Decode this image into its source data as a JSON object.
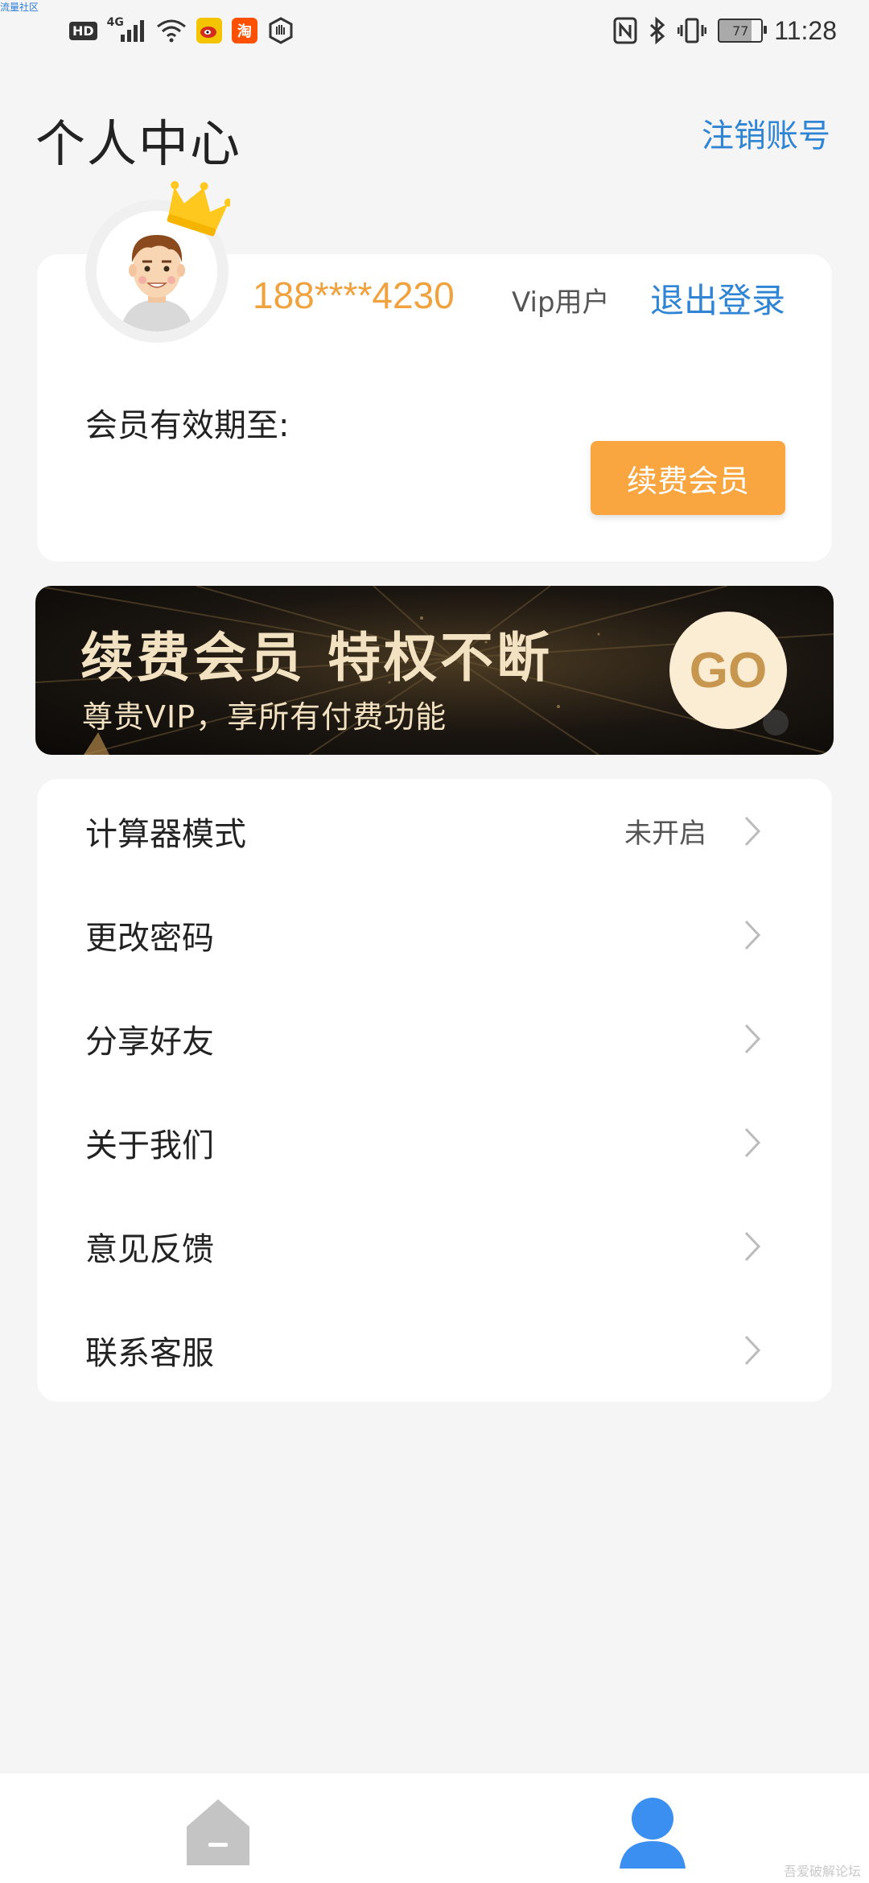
{
  "watermark_top": "流量社区",
  "status_bar": {
    "hd": "HD",
    "network": "4G",
    "weibo_icon": "weibo-icon",
    "taobao_label": "淘",
    "battery": "77",
    "time": "11:28"
  },
  "header": {
    "title": "个人中心",
    "cancel_account": "注销账号"
  },
  "profile": {
    "phone": "188****4230",
    "user_type": "Vip用户",
    "logout": "退出登录",
    "expiry_label": "会员有效期至:",
    "renew_button": "续费会员"
  },
  "banner": {
    "title": "续费会员 特权不断",
    "subtitle": "尊贵VIP，享所有付费功能",
    "go": "GO"
  },
  "menu": {
    "items": [
      {
        "label": "计算器模式",
        "value": "未开启"
      },
      {
        "label": "更改密码",
        "value": ""
      },
      {
        "label": "分享好友",
        "value": ""
      },
      {
        "label": "关于我们",
        "value": ""
      },
      {
        "label": "意见反馈",
        "value": ""
      },
      {
        "label": "联系客服",
        "value": ""
      }
    ]
  },
  "bottom_nav": {
    "home_icon": "home-icon",
    "user_icon": "user-icon",
    "active": "user"
  },
  "watermark_bottom": "吾爱破解论坛"
}
